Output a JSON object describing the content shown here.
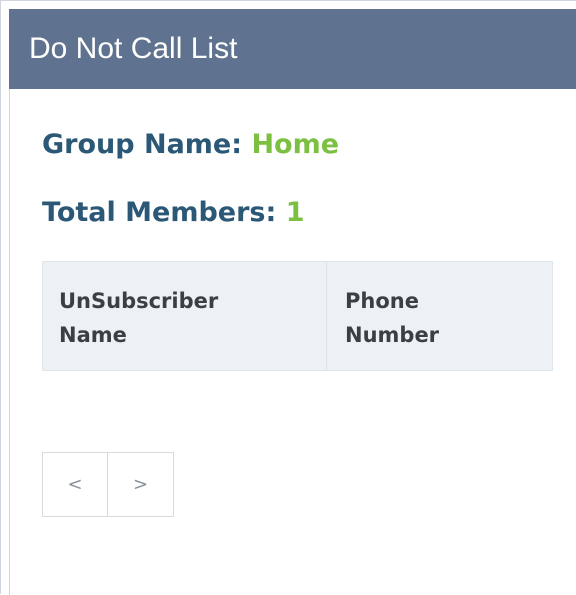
{
  "panel": {
    "title": "Do Not Call List"
  },
  "group": {
    "label": "Group Name:",
    "value": "Home"
  },
  "members": {
    "label": "Total Members:",
    "value": "1"
  },
  "table": {
    "columns": [
      {
        "line1": "UnSubscriber",
        "line2": "Name"
      },
      {
        "line1": "Phone",
        "line2": "Number"
      }
    ],
    "rows": []
  },
  "pager": {
    "prev_label": "<",
    "next_label": ">"
  },
  "colors": {
    "header_bg": "#5f7390",
    "label_text": "#2b5876",
    "value_text": "#7cc042",
    "table_header_bg": "#edf1f5"
  }
}
